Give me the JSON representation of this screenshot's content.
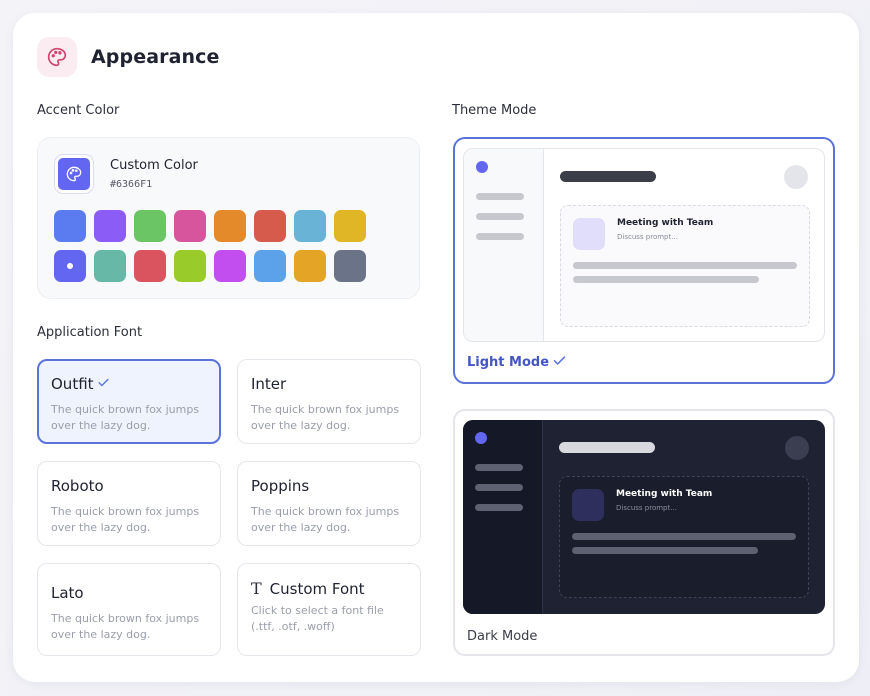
{
  "header": {
    "title": "Appearance",
    "icon": "palette-icon",
    "icon_bg": "#fbecf2",
    "icon_color": "#d1456f"
  },
  "accent": {
    "label": "Accent Color",
    "custom_name": "Custom Color",
    "custom_hex": "#6366F1",
    "swatches": [
      "#5b7cf0",
      "#8b5cf6",
      "#6cc565",
      "#d6559d",
      "#e58a2b",
      "#d65b4d",
      "#68b3d6",
      "#e0b526",
      "#6366f1",
      "#68b8a8",
      "#d9545f",
      "#99cc2a",
      "#c24ef0",
      "#5ca2ea",
      "#e4a526",
      "#6b7389"
    ],
    "selected_index": 8
  },
  "fonts": {
    "label": "Application Font",
    "sample": "The quick brown fox jumps over the lazy dog.",
    "items": [
      {
        "name": "Outfit",
        "selected": true
      },
      {
        "name": "Inter",
        "selected": false
      },
      {
        "name": "Roboto",
        "selected": false
      },
      {
        "name": "Poppins",
        "selected": false
      },
      {
        "name": "Lato",
        "selected": false
      }
    ],
    "custom": {
      "name": "Custom Font",
      "icon_glyph": "T",
      "hint": "Click to select a font file (.ttf, .otf, .woff)"
    }
  },
  "theme": {
    "label": "Theme Mode",
    "preview_title": "Meeting with Team",
    "preview_subtitle": "Discuss prompt...",
    "light_label": "Light Mode",
    "dark_label": "Dark Mode",
    "selected": "light",
    "accent": "#5b73d9"
  }
}
